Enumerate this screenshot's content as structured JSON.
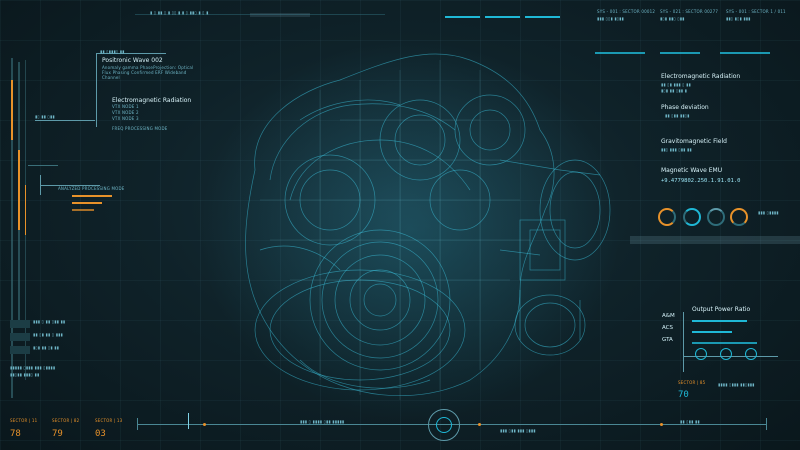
{
  "colors": {
    "accent": "#1fb8d6",
    "orange": "#e8922a",
    "text": "#d6f4fb",
    "dim": "#5d9aa9"
  },
  "left_panel": {
    "title": "Positronic Wave 002",
    "desc": "Anomaly gamma PhaseProjection: Optical Flux Phasing Confirmed ERF Wideband Channel",
    "sub_title": "Electromagnetic Radiation",
    "rows": [
      "VTX NODE 1",
      "VTX NODE 2",
      "VTX NODE 3",
      "FREQ PROCESSING MODE"
    ],
    "analyzer_label": "ANALYZED PROCESSING MODE"
  },
  "right_panels": [
    {
      "title": "Electromagnetic Radiation"
    },
    {
      "title": "Phase deviation"
    },
    {
      "title": "Gravitomagnetic Field"
    },
    {
      "title": "Magnetic Wave EMU"
    }
  ],
  "magnetic_readout": "+9.4779802.250.1.91.01.0",
  "output_panel": {
    "title": "Output Power Ratio",
    "labels": [
      "A&M",
      "ACS",
      "GTA"
    ]
  },
  "sector_bottom_right": {
    "label": "SECTOR | 85",
    "value": "70"
  },
  "sectors": [
    {
      "label": "SECTOR | 11",
      "value": "78"
    },
    {
      "label": "SECTOR | 82",
      "value": "79"
    },
    {
      "label": "SECTOR | 13",
      "value": "03"
    }
  ],
  "top_right_headers": [
    "SYS - 001 : SECTOR 00012",
    "SYS - 021 : SECTOR 00277",
    "SYS - 001 : SECTOR 1 / 011"
  ]
}
